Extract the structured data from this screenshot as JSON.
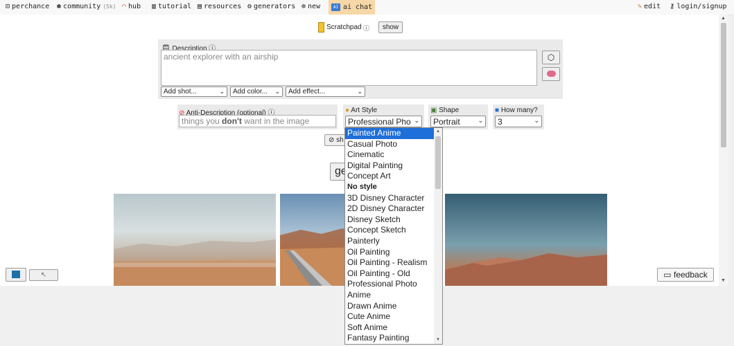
{
  "nav": {
    "perchance": "perchance",
    "community": "community",
    "community_tag": "(5k)",
    "hub": "hub",
    "tutorial": "tutorial",
    "resources": "resources",
    "generators": "generators",
    "new": "new",
    "ai_chat": "ai chat",
    "edit": "edit",
    "login": "login/signup"
  },
  "scratchpad": {
    "label": "Scratchpad",
    "show_button": "show"
  },
  "description": {
    "label": "Description",
    "value": "ancient explorer with an airship",
    "add_shot": "Add shot...",
    "add_color": "Add color...",
    "add_effect": "Add effect..."
  },
  "anti_description": {
    "label": "Anti-Description (optional)",
    "placeholder_pre": "things you ",
    "placeholder_bold": "don't",
    "placeholder_post": " want in the image"
  },
  "art_style": {
    "label": "Art Style",
    "selected": "Professional Pho",
    "options": [
      "Painted Anime",
      "Casual Photo",
      "Cinematic",
      "Digital Painting",
      "Concept Art",
      "No style",
      "3D Disney Character",
      "2D Disney Character",
      "Disney Sketch",
      "Concept Sketch",
      "Painterly",
      "Oil Painting",
      "Oil Painting - Realism",
      "Oil Painting - Old",
      "Professional Photo",
      "Anime",
      "Drawn Anime",
      "Cute Anime",
      "Soft Anime",
      "Fantasy Painting"
    ],
    "highlighted_index": 0,
    "bold_index": 5
  },
  "shape": {
    "label": "Shape",
    "selected": "Portrait"
  },
  "how_many": {
    "label": "How many?",
    "selected": "3"
  },
  "partial": {
    "share": "sh",
    "generate": "ge"
  },
  "feedback": "feedback",
  "colors": {
    "accent": "#1e6fd9",
    "ai_chat_bg": "#f6d7a7",
    "panel_bg": "#eaeaea"
  }
}
